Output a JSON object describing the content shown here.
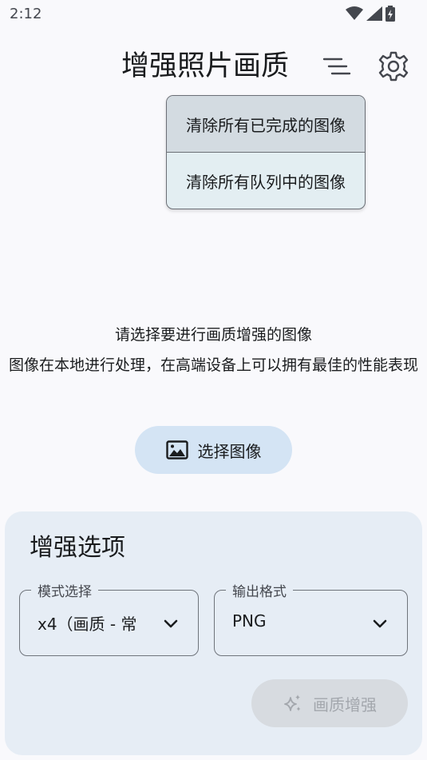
{
  "status_bar": {
    "time": "2:12",
    "icons": [
      "wifi-icon",
      "signal-icon",
      "battery-charging-icon"
    ]
  },
  "header": {
    "title": "增强照片画质",
    "menu_icon": "sort-menu-icon",
    "settings_icon": "gear-icon"
  },
  "dropdown": {
    "items": [
      {
        "label": "清除所有已完成的图像"
      },
      {
        "label": "清除所有队列中的图像"
      }
    ]
  },
  "main": {
    "prompt": "请选择要进行画质增强的图像",
    "description": "图像在本地进行处理，在高端设备上可以拥有最佳的性能表现",
    "choose_button": "选择图像",
    "choose_icon": "image-icon"
  },
  "options": {
    "title": "增强选项",
    "mode_label": "模式选择",
    "mode_value": "x4（画质 - 常",
    "format_label": "输出格式",
    "format_value": "PNG",
    "enhance_button": "画质增强",
    "enhance_icon": "sparkle-icon"
  },
  "colors": {
    "background": "#f9f9fc",
    "button_tonal": "#d4e4f4",
    "card": "#e6edf5",
    "disabled_button": "#d7dbe0"
  }
}
